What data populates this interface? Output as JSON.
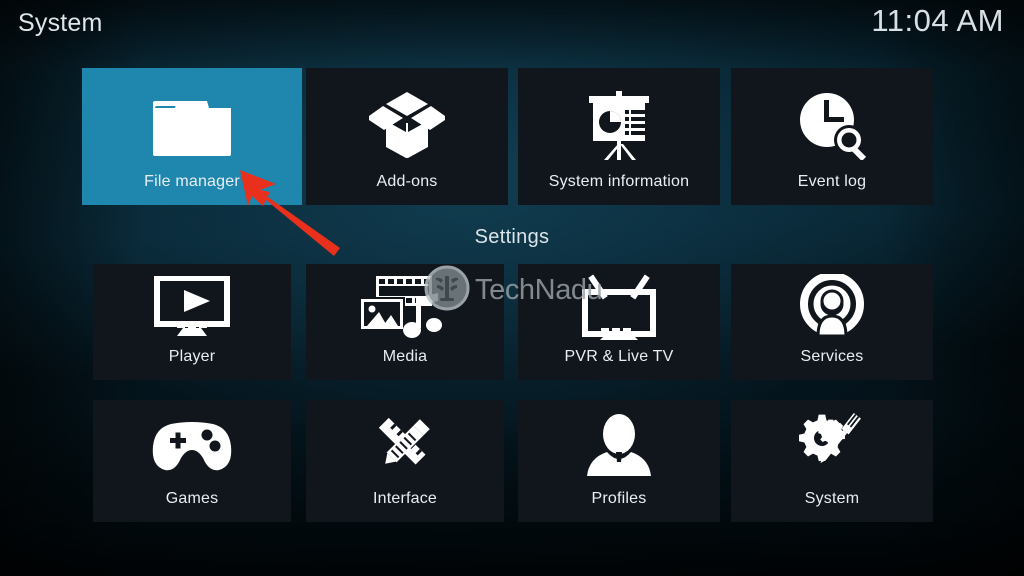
{
  "header": {
    "title": "System",
    "clock": "11:04 AM"
  },
  "section": {
    "settings_heading": "Settings"
  },
  "watermark": {
    "text": "TechNadu",
    "logo_icon": "technadu-circle-logo",
    "color": "#9aa3a8"
  },
  "annotation": {
    "arrow_icon": "red-arrow-pointing-to-file-manager",
    "color": "#e8301c"
  },
  "colors": {
    "selected_tile": "#1f86ae",
    "tile_background": "#11161c",
    "text": "#e8eef2",
    "background": "#0a3142"
  },
  "top_row": [
    {
      "label": "File manager",
      "icon": "folder-icon",
      "selected": true
    },
    {
      "label": "Add-ons",
      "icon": "open-box-icon",
      "selected": false
    },
    {
      "label": "System information",
      "icon": "presentation-chart-icon",
      "selected": false
    },
    {
      "label": "Event log",
      "icon": "clock-search-icon",
      "selected": false
    }
  ],
  "settings_rows": [
    [
      {
        "label": "Player",
        "icon": "monitor-play-icon",
        "selected": false
      },
      {
        "label": "Media",
        "icon": "film-photo-music-icon",
        "selected": false
      },
      {
        "label": "PVR & Live TV",
        "icon": "tv-antenna-icon",
        "selected": false
      },
      {
        "label": "Services",
        "icon": "broadcast-person-icon",
        "selected": false
      }
    ],
    [
      {
        "label": "Games",
        "icon": "gamepad-icon",
        "selected": false
      },
      {
        "label": "Interface",
        "icon": "pencil-ruler-icon",
        "selected": false
      },
      {
        "label": "Profiles",
        "icon": "person-bust-icon",
        "selected": false
      },
      {
        "label": "System",
        "icon": "gear-tools-icon",
        "selected": false
      }
    ]
  ]
}
